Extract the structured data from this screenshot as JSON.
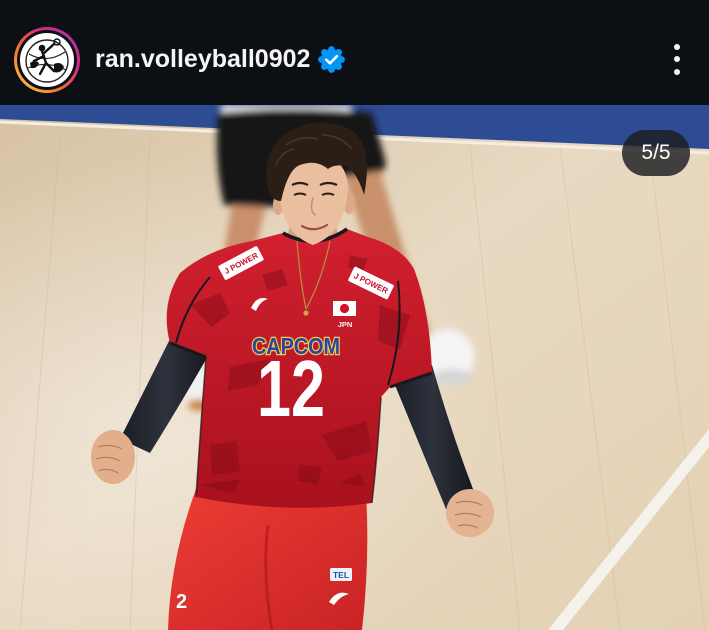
{
  "post": {
    "header": {
      "username": "ran.volleyball0902",
      "verified": true,
      "avatar_icon": "profile-avatar",
      "verified_icon": "verified-badge-icon",
      "menu_icon": "more-vertical-icon"
    },
    "carousel": {
      "counter_label": "5/5"
    },
    "photo": {
      "jersey_sponsor": "CAPCOM",
      "jersey_number": "12",
      "chest_patch": "JPN",
      "shoulder_patch": "J POWER",
      "shorts_patch": "TEL",
      "shorts_number": "2"
    }
  },
  "colors": {
    "header_bg": "#0c1014",
    "text_primary": "#f5f5f5",
    "verified_blue": "#0095f6",
    "badge_bg": "#1c1d20",
    "story_ring": [
      "#fdd55d",
      "#f77b2a",
      "#d8287a",
      "#a03bbd"
    ]
  }
}
